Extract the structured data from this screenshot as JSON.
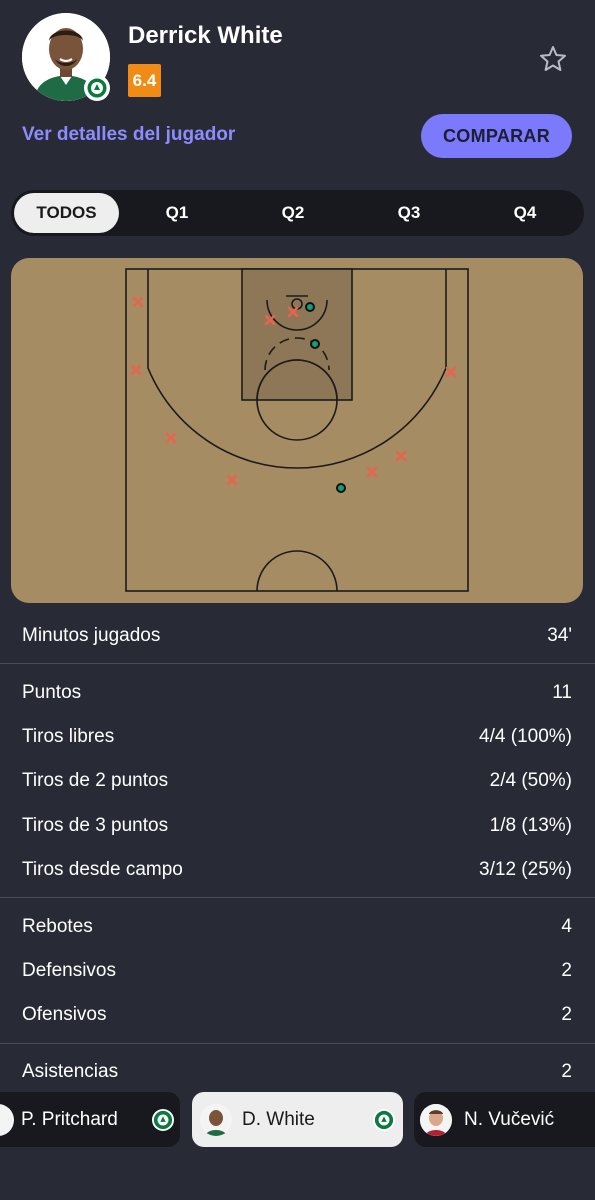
{
  "player": {
    "name": "Derrick White",
    "rating": "6.4",
    "details_link": "Ver detalles del jugador",
    "compare_label": "COMPARAR",
    "colors": {
      "rating_bg": "#f08c16",
      "accent": "#7b7afc",
      "link": "#8d8cff"
    }
  },
  "tabs": [
    {
      "label": "TODOS",
      "active": true
    },
    {
      "label": "Q1",
      "active": false
    },
    {
      "label": "Q2",
      "active": false
    },
    {
      "label": "Q3",
      "active": false
    },
    {
      "label": "Q4",
      "active": false
    }
  ],
  "shot_chart": {
    "legend": {
      "made_color": "#0e9f7e",
      "missed_color": "#e8644f"
    },
    "shots": [
      {
        "result": "missed",
        "zone": "left-corner-3-upper"
      },
      {
        "result": "missed",
        "zone": "paint-left"
      },
      {
        "result": "missed",
        "zone": "paint-center"
      },
      {
        "result": "made",
        "zone": "paint-right"
      },
      {
        "result": "made",
        "zone": "free-throw-lane"
      },
      {
        "result": "missed",
        "zone": "left-wing-3"
      },
      {
        "result": "missed",
        "zone": "right-wing-3"
      },
      {
        "result": "missed",
        "zone": "left-45-3"
      },
      {
        "result": "missed",
        "zone": "left-top-3"
      },
      {
        "result": "made",
        "zone": "top-3"
      },
      {
        "result": "missed",
        "zone": "right-top-3"
      },
      {
        "result": "missed",
        "zone": "right-45-3"
      }
    ]
  },
  "stats": {
    "minutes": {
      "label": "Minutos jugados",
      "value": "34'"
    },
    "scoring": [
      {
        "label": "Puntos",
        "value": "11"
      },
      {
        "label": "Tiros libres",
        "value": "4/4 (100%)"
      },
      {
        "label": "Tiros de 2 puntos",
        "value": "2/4 (50%)"
      },
      {
        "label": "Tiros de 3 puntos",
        "value": "1/8 (13%)"
      },
      {
        "label": "Tiros desde campo",
        "value": "3/12 (25%)"
      }
    ],
    "rebounds": [
      {
        "label": "Rebotes",
        "value": "4"
      },
      {
        "label": "Defensivos",
        "value": "2"
      },
      {
        "label": "Ofensivos",
        "value": "2"
      }
    ],
    "assists": {
      "label": "Asistencias",
      "value": "2"
    }
  },
  "player_switcher": [
    {
      "name": "P. Pritchard",
      "selected": false
    },
    {
      "name": "D. White",
      "selected": true
    },
    {
      "name": "N. Vučević",
      "selected": false
    }
  ]
}
